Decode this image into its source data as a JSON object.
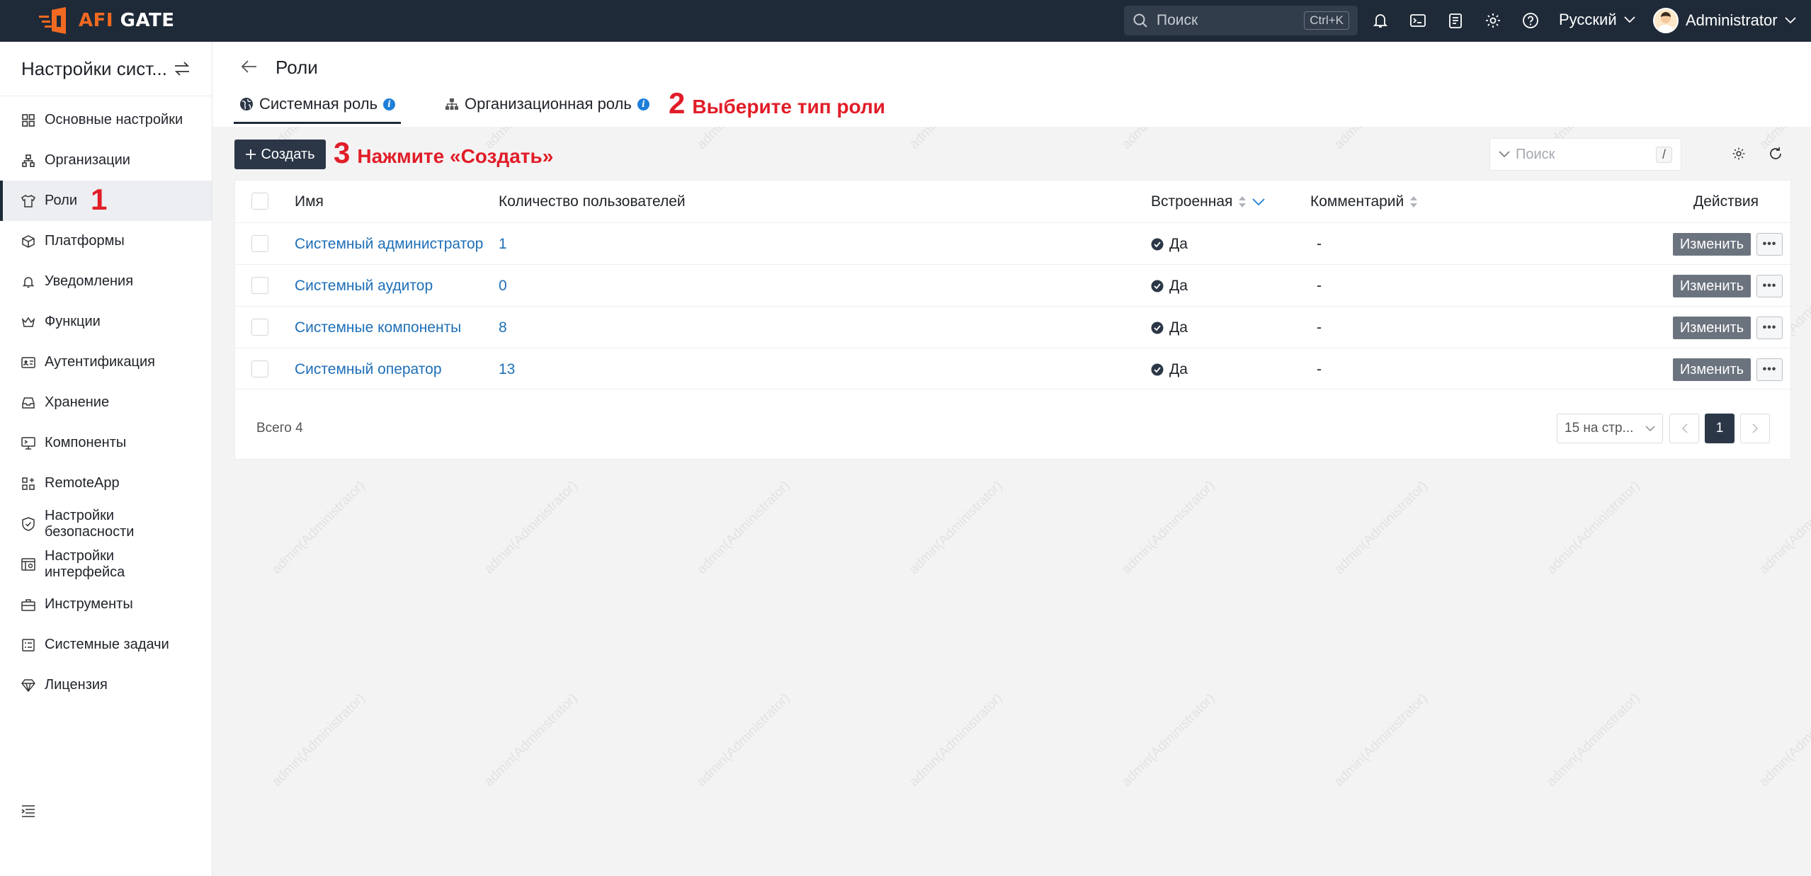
{
  "brand": {
    "afi": "AFI",
    "gate": " GATE"
  },
  "topbar": {
    "search_placeholder": "Поиск",
    "search_shortcut": "Ctrl+K",
    "language": "Русский",
    "user": "Administrator"
  },
  "sidebar": {
    "title": "Настройки сист...",
    "items": [
      {
        "label": "Основные настройки",
        "icon": "grid-icon"
      },
      {
        "label": "Организации",
        "icon": "org-tree-icon"
      },
      {
        "label": "Роли",
        "icon": "shirt-icon",
        "active": true
      },
      {
        "label": "Платформы",
        "icon": "cube-icon"
      },
      {
        "label": "Уведомления",
        "icon": "bell-icon"
      },
      {
        "label": "Функции",
        "icon": "crown-icon"
      },
      {
        "label": "Аутентификация",
        "icon": "id-card-icon"
      },
      {
        "label": "Хранение",
        "icon": "inbox-icon"
      },
      {
        "label": "Компоненты",
        "icon": "monitor-icon"
      },
      {
        "label": "RemoteApp",
        "icon": "apps-icon"
      },
      {
        "label_1": "Настройки",
        "label_2": "безопасности",
        "icon": "shield-check-icon"
      },
      {
        "label_1": "Настройки",
        "label_2": "интерфейса",
        "icon": "window-icon"
      },
      {
        "label": "Инструменты",
        "icon": "toolbox-icon"
      },
      {
        "label": "Системные задачи",
        "icon": "tasks-icon"
      },
      {
        "label": "Лицензия",
        "icon": "diamond-icon"
      }
    ]
  },
  "annotations": {
    "a1": "1",
    "a2_num": "2",
    "a2_text": "Выберите тип роли",
    "a3_num": "3",
    "a3_text": "Нажмите «Создать»"
  },
  "page": {
    "title": "Роли",
    "tabs": [
      {
        "label": "Системная роль",
        "active": true
      },
      {
        "label": "Организационная роль"
      }
    ],
    "create_label": "Создать",
    "search_placeholder": "Поиск",
    "search_shortcut": "/"
  },
  "table": {
    "headers": {
      "name": "Имя",
      "users": "Количество пользователей",
      "builtin": "Встроенная",
      "comment": "Комментарий",
      "actions": "Действия"
    },
    "rows": [
      {
        "name": "Системный администратор",
        "users": "1",
        "builtin": "Да",
        "comment": "-",
        "edit": "Изменить"
      },
      {
        "name": "Системный аудитор",
        "users": "0",
        "builtin": "Да",
        "comment": "-",
        "edit": "Изменить"
      },
      {
        "name": "Системные компоненты",
        "users": "8",
        "builtin": "Да",
        "comment": "-",
        "edit": "Изменить"
      },
      {
        "name": "Системный оператор",
        "users": "13",
        "builtin": "Да",
        "comment": "-",
        "edit": "Изменить"
      }
    ],
    "total": "Всего 4",
    "per_page": "15 на стр...",
    "current_page": "1"
  },
  "watermark": "admin(Administrator)",
  "colors": {
    "topbar": "#1f2a38",
    "brand_orange": "#f26a21",
    "link": "#1e6fb8",
    "annotation": "#e11d28"
  }
}
